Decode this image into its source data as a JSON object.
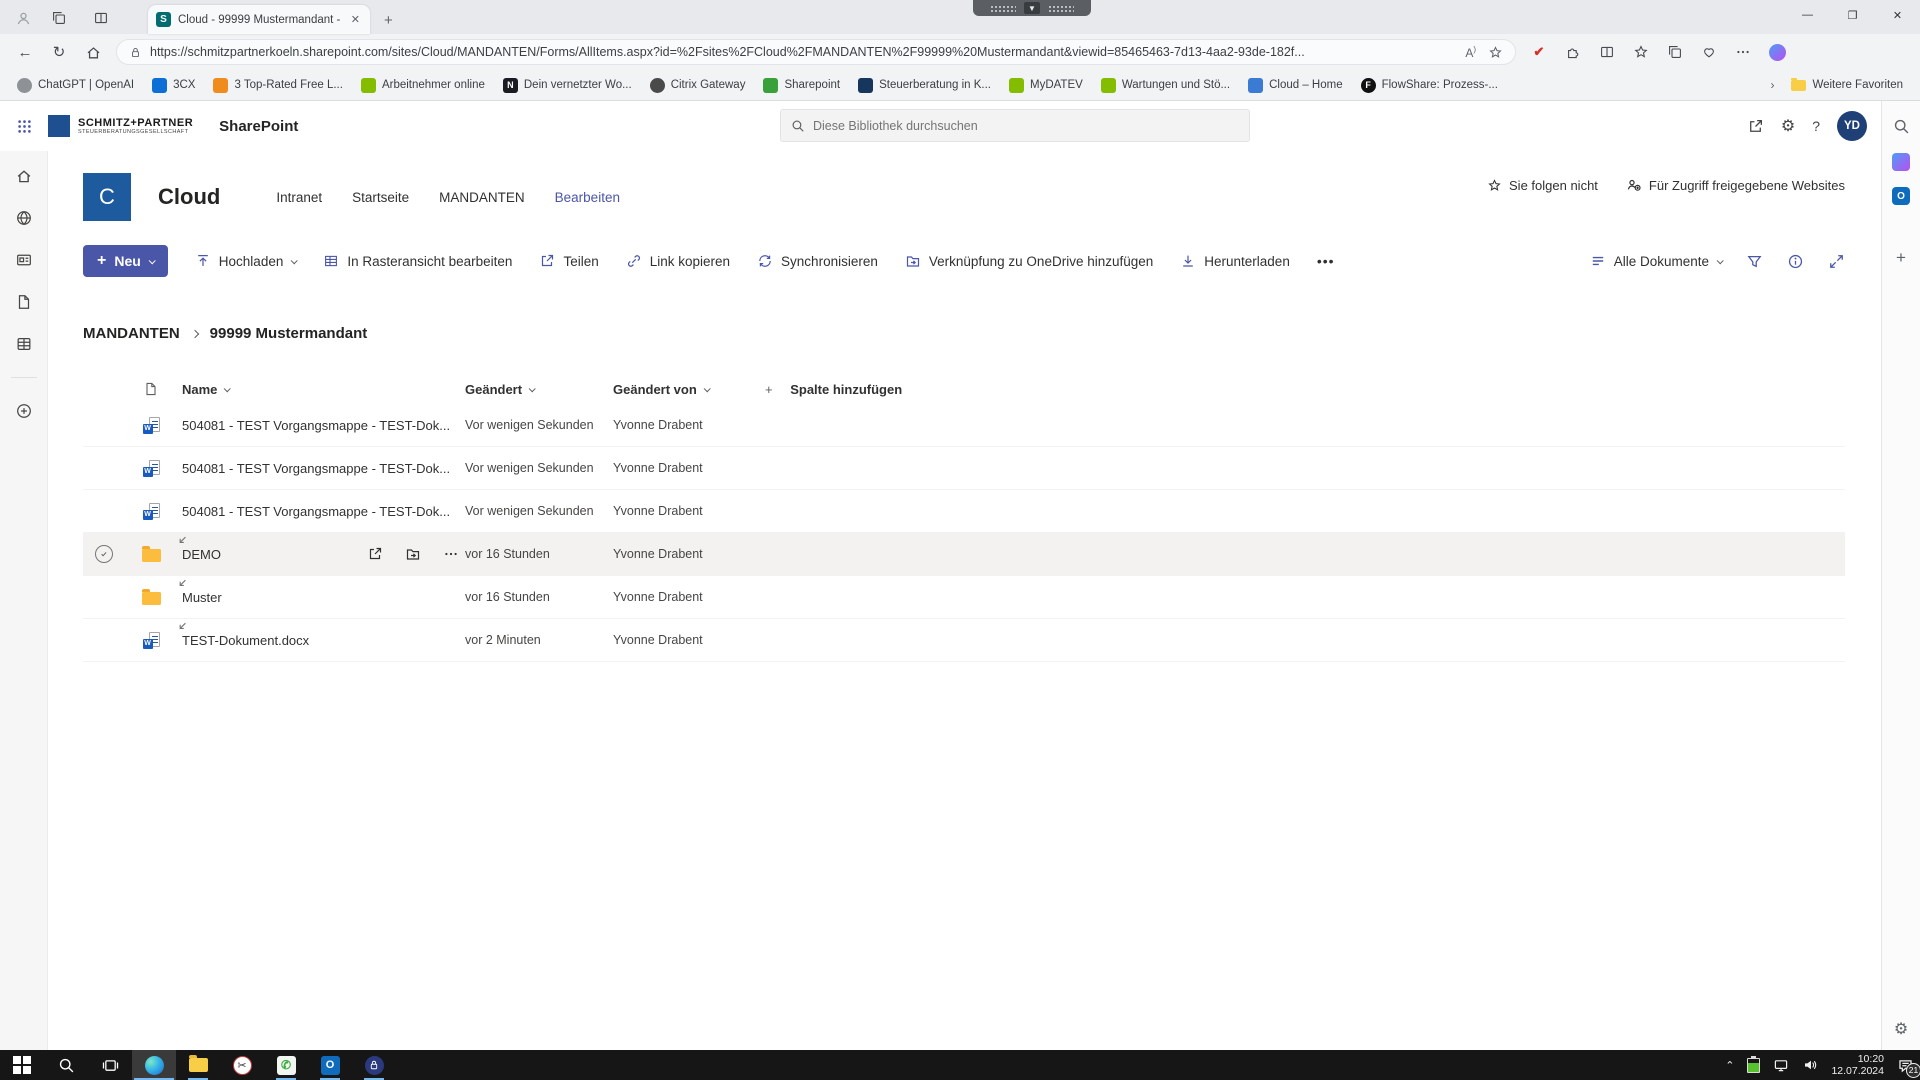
{
  "browser": {
    "tab_title": "Cloud - 99999 Mustermandant -",
    "url": "https://schmitzpartnerkoeln.sharepoint.com/sites/Cloud/MANDANTEN/Forms/AllItems.aspx?id=%2Fsites%2FCloud%2FMANDANTEN%2F99999%20Mustermandant&viewid=85465463-7d13-4aa2-93de-182f...",
    "reader_icon_label": "A",
    "bookmarks": [
      {
        "label": "ChatGPT | OpenAI",
        "color": "#8e9196",
        "glyph": ""
      },
      {
        "label": "3CX",
        "color": "#0b6fd6",
        "glyph": ""
      },
      {
        "label": "3 Top-Rated Free L...",
        "color": "#f08c1e",
        "glyph": ""
      },
      {
        "label": "Arbeitnehmer online",
        "color": "#84bd00",
        "glyph": ""
      },
      {
        "label": "Dein vernetzter Wo...",
        "color": "#1b1b24",
        "glyph": "N"
      },
      {
        "label": "Citrix Gateway",
        "color": "#4a4a4a",
        "glyph": ""
      },
      {
        "label": "Sharepoint",
        "color": "#3aa03a",
        "glyph": ""
      },
      {
        "label": "Steuerberatung in K...",
        "color": "#17365d",
        "glyph": ""
      },
      {
        "label": "MyDATEV",
        "color": "#84bd00",
        "glyph": ""
      },
      {
        "label": "Wartungen und Stö...",
        "color": "#84bd00",
        "glyph": ""
      },
      {
        "label": "Cloud – Home",
        "color": "#3b7bd4",
        "glyph": ""
      },
      {
        "label": "FlowShare: Prozess-...",
        "color": "#101010",
        "glyph": "F"
      }
    ],
    "more_favorites_label": "Weitere Favoriten"
  },
  "suite": {
    "brand_name": "SCHMITZ+PARTNER",
    "brand_sub": "STEUERBERATUNGSGESELLSCHAFT",
    "app_name": "SharePoint",
    "search_placeholder": "Diese Bibliothek durchsuchen",
    "avatar_initials": "YD"
  },
  "site": {
    "logo_letter": "C",
    "title": "Cloud",
    "nav": [
      {
        "label": "Intranet"
      },
      {
        "label": "Startseite"
      },
      {
        "label": "MANDANTEN"
      },
      {
        "label": "Bearbeiten"
      }
    ],
    "follow_label": "Sie folgen nicht",
    "shared_sites_label": "Für Zugriff freigegebene Websites"
  },
  "commands": {
    "new_label": "Neu",
    "upload_label": "Hochladen",
    "grid_edit_label": "In Rasteransicht bearbeiten",
    "share_label": "Teilen",
    "copy_link_label": "Link kopieren",
    "sync_label": "Synchronisieren",
    "onedrive_label": "Verknüpfung zu OneDrive hinzufügen",
    "download_label": "Herunterladen",
    "more_label": "•••",
    "view_label": "Alle Dokumente"
  },
  "breadcrumb": {
    "parent": "MANDANTEN",
    "current": "99999 Mustermandant"
  },
  "table": {
    "columns": {
      "name": "Name",
      "modified": "Geändert",
      "modified_by": "Geändert von",
      "add_column": "Spalte hinzufügen"
    },
    "rows": [
      {
        "name": "504081 - TEST Vorgangsmappe - TEST-Dok...",
        "type": "word",
        "modified": "Vor wenigen Sekunden",
        "modified_by": "Yvonne Drabent"
      },
      {
        "name": "504081 - TEST Vorgangsmappe - TEST-Dok...",
        "type": "word",
        "modified": "Vor wenigen Sekunden",
        "modified_by": "Yvonne Drabent"
      },
      {
        "name": "504081 - TEST Vorgangsmappe - TEST-Dok...",
        "type": "word",
        "modified": "Vor wenigen Sekunden",
        "modified_by": "Yvonne Drabent"
      },
      {
        "name": "DEMO",
        "type": "folder",
        "modified": "vor 16 Stunden",
        "modified_by": "Yvonne Drabent"
      },
      {
        "name": "Muster",
        "type": "folder",
        "modified": "vor 16 Stunden",
        "modified_by": "Yvonne Drabent"
      },
      {
        "name": "TEST-Dokument.docx",
        "type": "word",
        "modified": "vor 2 Minuten",
        "modified_by": "Yvonne Drabent"
      }
    ]
  },
  "taskbar": {
    "time": "10:20",
    "date": "12.07.2024",
    "notification_count": "21"
  },
  "colors": {
    "accent": "#4a56a8",
    "word_blue": "#185abd",
    "folder_yellow": "#fcbd3f",
    "selected_row": "#f3f2f1",
    "taskbar_underline": "#76b9ed",
    "site_logo_blue": "#1e5b9e"
  },
  "icons": {
    "search-icon": "magnifier",
    "settings-gear-icon": "⚙",
    "help-icon": "?",
    "waffle-icon": "3x3 dot grid",
    "home-icon": "house outline",
    "globe-icon": "globe outline",
    "upload-icon": "arrow up with bar",
    "download-icon": "arrow down with bar",
    "sync-icon": "circular arrows",
    "share-icon": "box with outgoing arrow",
    "link-icon": "chain link",
    "filter-icon": "funnel",
    "info-icon": "circled i",
    "expand-icon": "diagonal arrows",
    "star-icon": "☆",
    "folder-icon": "yellow folder",
    "word-file-icon": "blue W document"
  }
}
